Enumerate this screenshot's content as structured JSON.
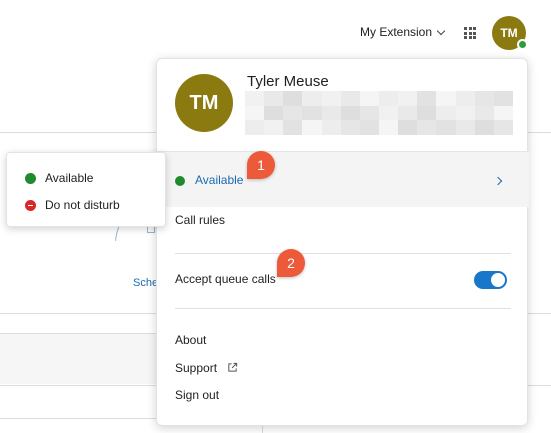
{
  "header": {
    "extension_label": "My Extension",
    "avatar_initials": "TM"
  },
  "background": {
    "schedule_label_partial": "Sche"
  },
  "profile_menu": {
    "avatar_initials": "TM",
    "user_name": "Tyler Meuse",
    "status_label": "Available",
    "items": {
      "call_rules": "Call rules",
      "accept_queue_calls": "Accept queue calls",
      "about": "About",
      "support": "Support",
      "sign_out": "Sign out"
    },
    "accept_queue_calls_enabled": true
  },
  "status_flyout": {
    "options": [
      {
        "label": "Available",
        "color": "#1f8a2e"
      },
      {
        "label": "Do not disturb",
        "color": "#d92626"
      }
    ]
  },
  "callouts": [
    "1",
    "2"
  ],
  "colors": {
    "avatar": "#8b7a10",
    "link_blue": "#1a6bb3",
    "toggle_on": "#1877c9",
    "callout": "#ec5a3a",
    "status_available": "#2e9c3b"
  }
}
